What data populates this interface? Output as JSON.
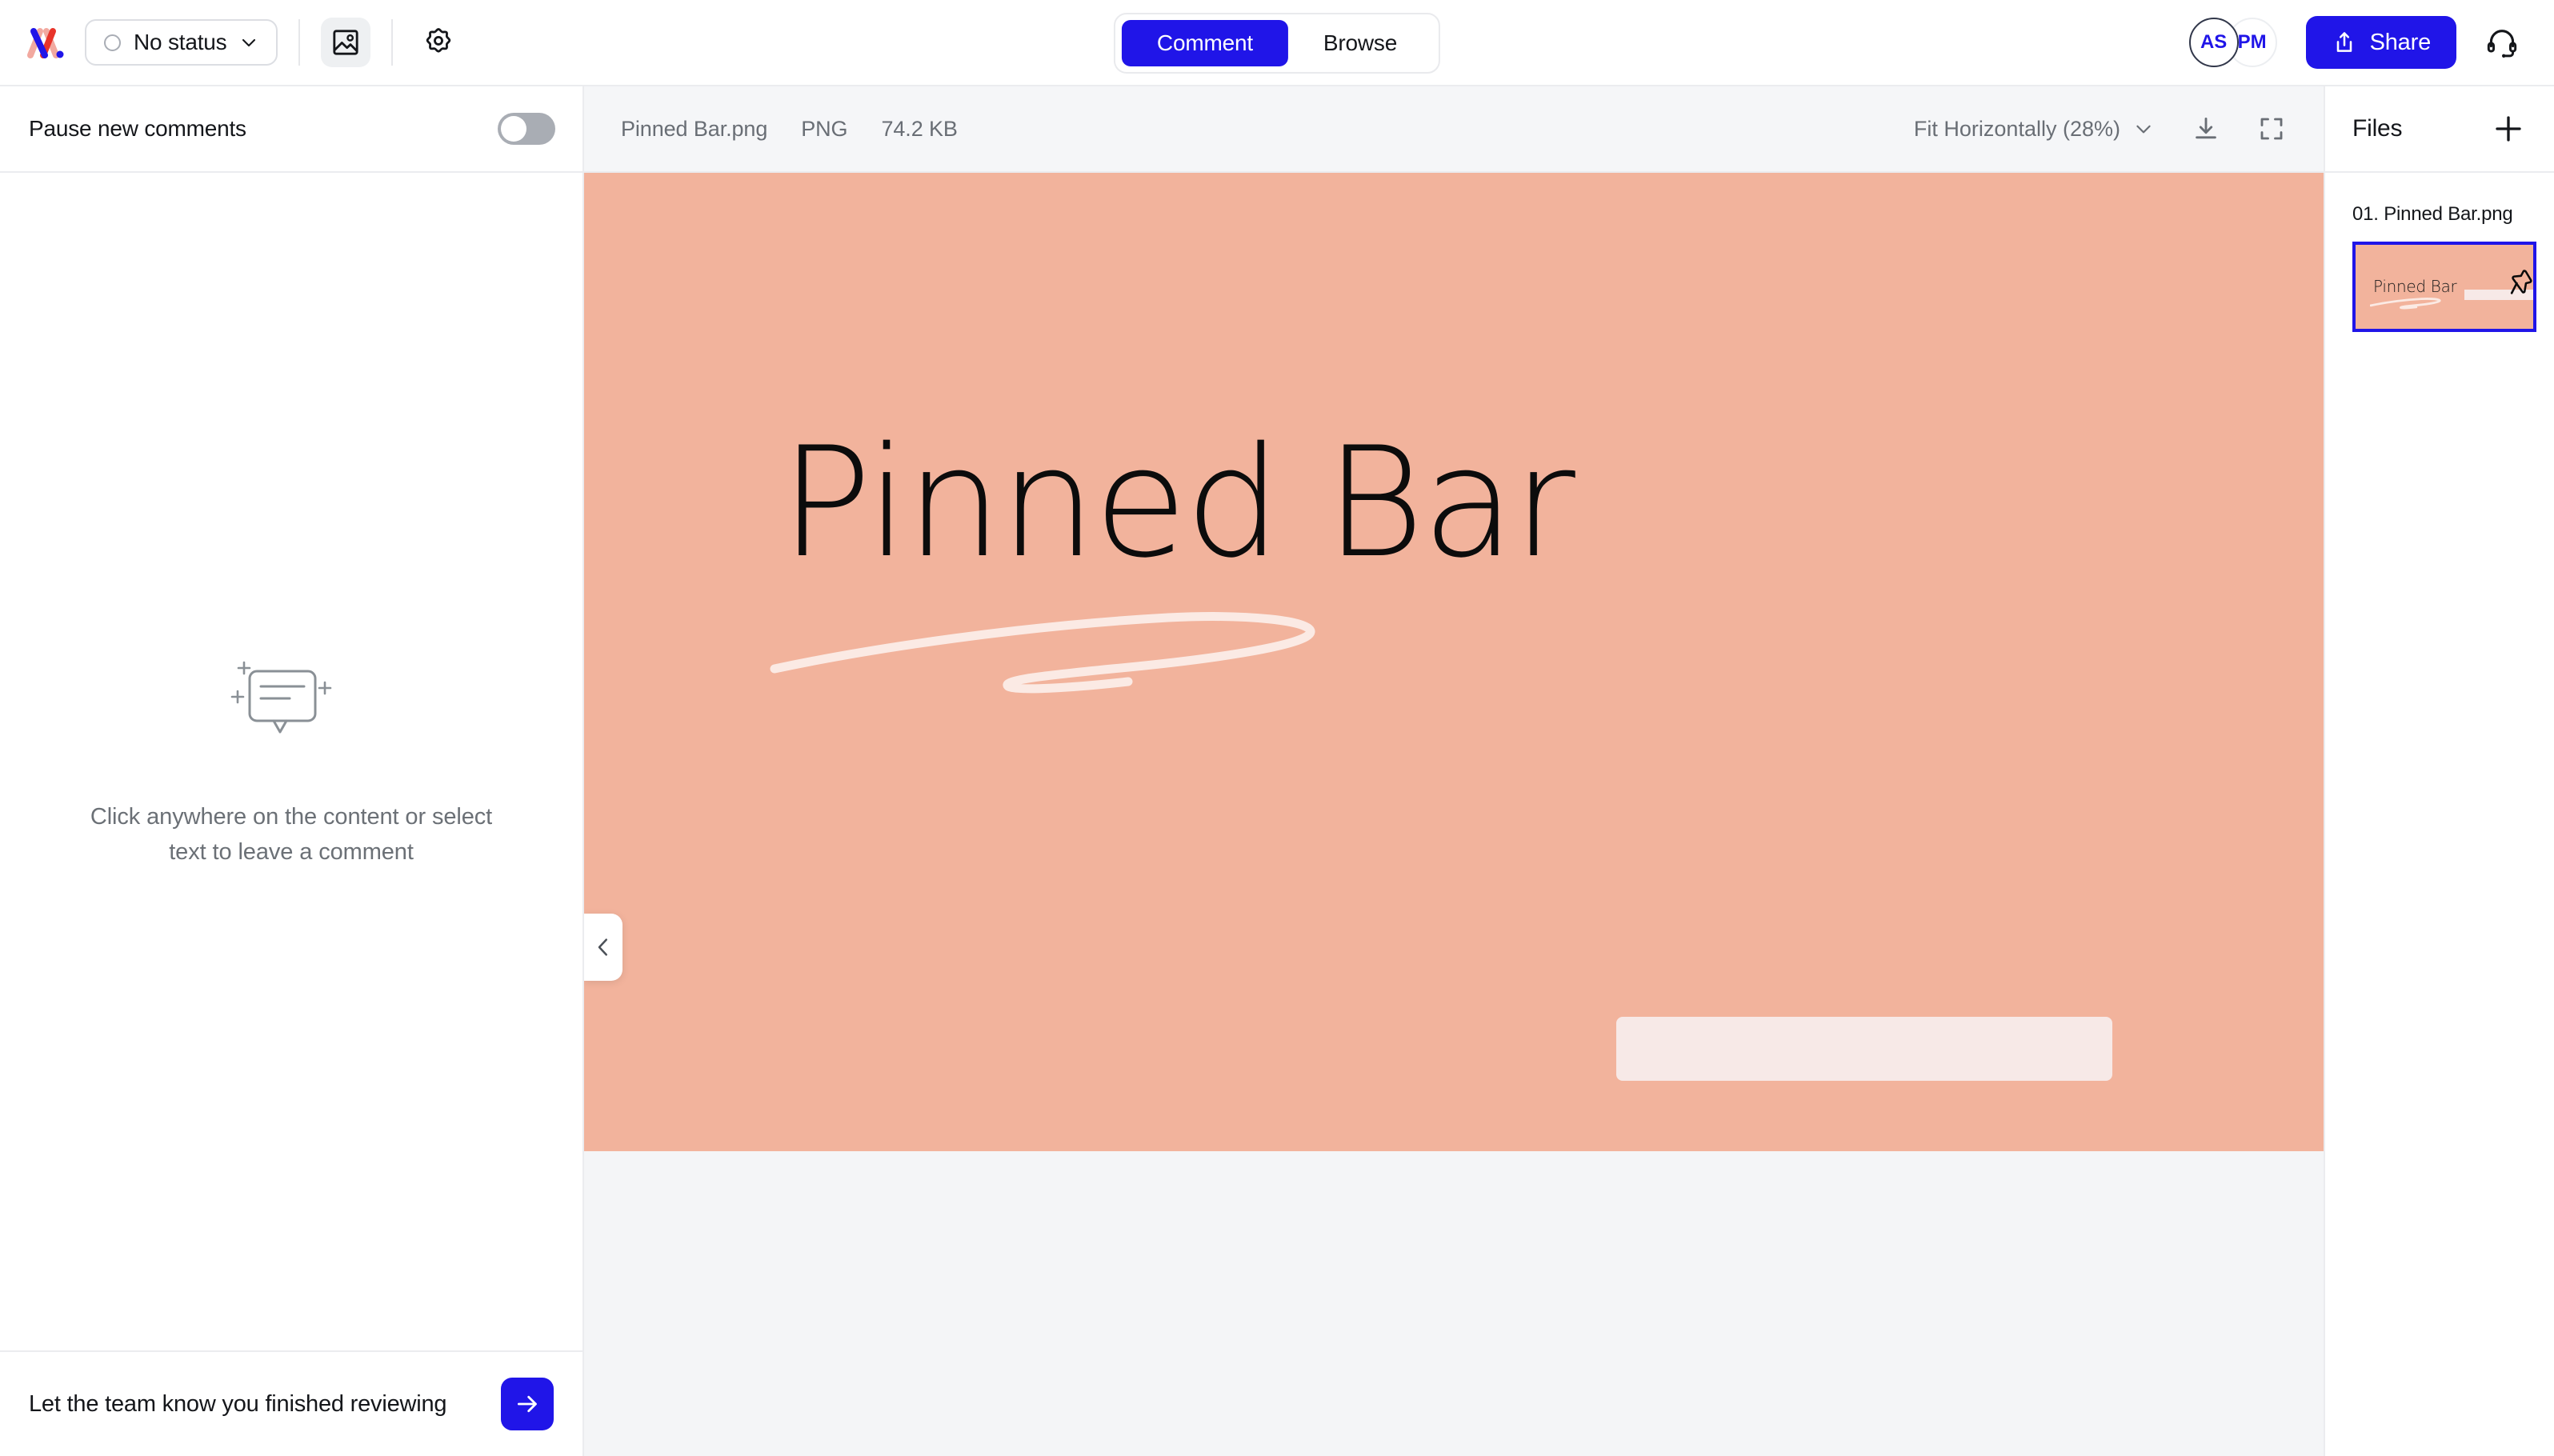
{
  "colors": {
    "accent": "#2015e8",
    "artboard_bg": "#f2b39c",
    "artboard_bar": "#f7e9e7",
    "viewer_bg": "#f4f5f7",
    "toolbar_bg": "#f5f6f8",
    "border": "#ebecef",
    "muted_text": "#696e75"
  },
  "topbar": {
    "logo_name": "markup-logo",
    "status": {
      "label": "No status",
      "icon": "circle-outline-icon",
      "chevron": "chevron-down-icon"
    },
    "image_toggle_icon": "image-icon",
    "settings_icon": "gear-icon",
    "tabs": [
      {
        "label": "Comment",
        "selected": true
      },
      {
        "label": "Browse",
        "selected": false
      }
    ],
    "avatars": [
      {
        "initials": "AS",
        "active": true
      },
      {
        "initials": "PM",
        "active": false
      }
    ],
    "share": {
      "label": "Share",
      "icon": "share-upload-icon"
    },
    "help_icon": "headset-icon"
  },
  "comments_panel": {
    "pause_label": "Pause new comments",
    "pause_enabled": false,
    "empty_icon": "comment-bubble-sparkle-icon",
    "empty_text": "Click anywhere on the content or select text to leave a comment",
    "footer_label": "Let the team know you finished reviewing",
    "footer_button_icon": "arrow-right-icon"
  },
  "viewer": {
    "file_name": "Pinned Bar.png",
    "file_type": "PNG",
    "file_size": "74.2 KB",
    "zoom": {
      "label": "Fit Horizontally (28%)",
      "chevron": "chevron-down-icon"
    },
    "download_icon": "download-icon",
    "fullscreen_icon": "fullscreen-icon",
    "collapse_icon": "chevron-left-icon",
    "artwork": {
      "title": "Pinned Bar",
      "underline": "hand-drawn-swoosh",
      "pin": "pushpin-icon",
      "bar": "light-rounded-bar"
    }
  },
  "files_panel": {
    "title": "Files",
    "add_icon": "plus-icon",
    "items": [
      {
        "label": "01. Pinned Bar.png",
        "selected": true,
        "thumb_title": "Pinned Bar"
      }
    ]
  }
}
